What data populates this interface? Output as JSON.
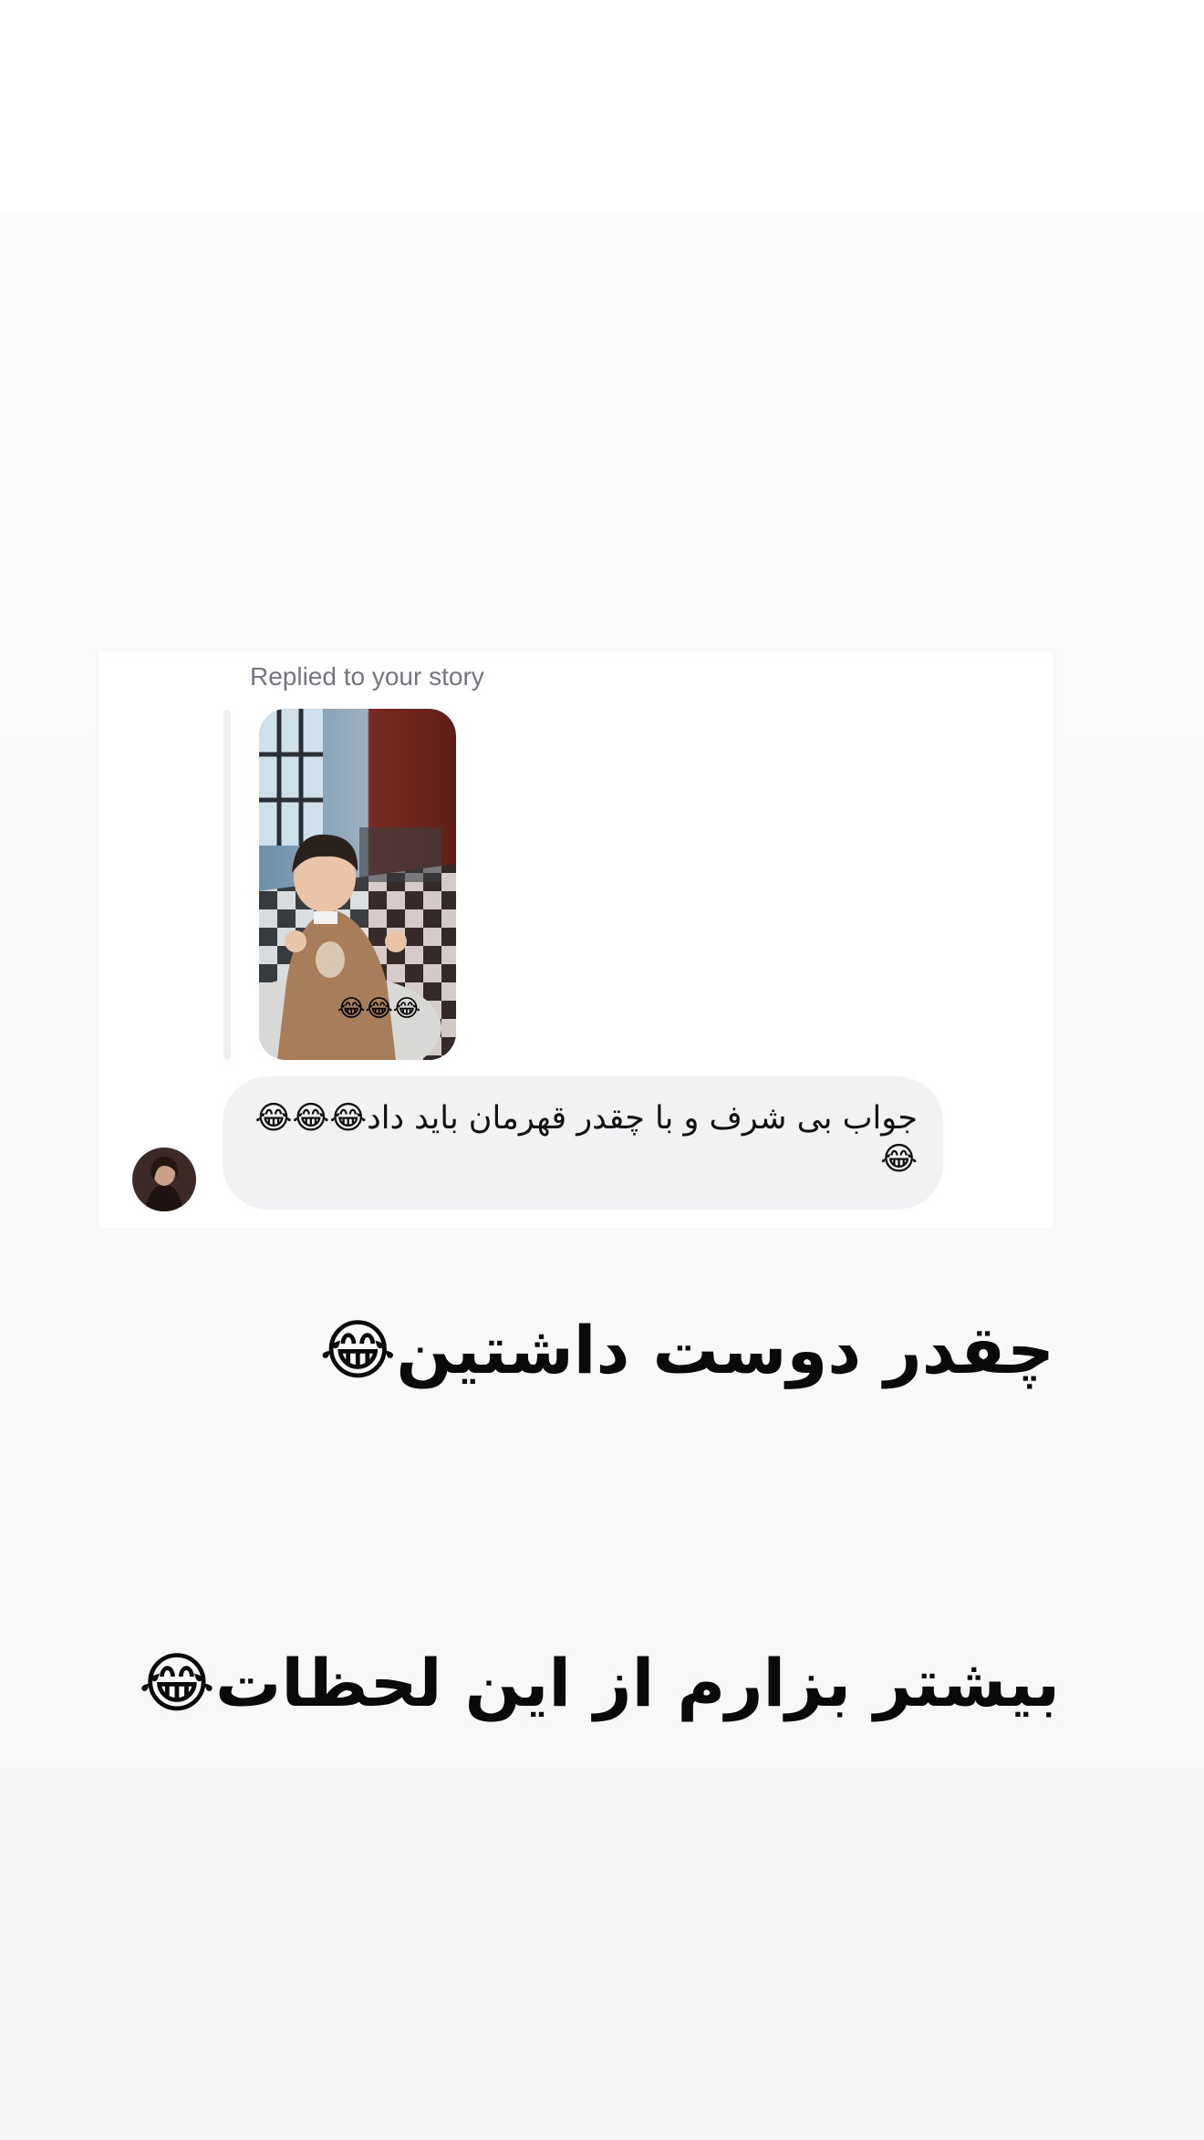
{
  "story_reply": {
    "label": "Replied to your story",
    "thumbnail_icon": "story-photo",
    "thumbnail_overlay_text": "😂😂😂"
  },
  "message": {
    "text": "جواب بی شرف و با چقدر قهرمان باید داد😂😂😂😂",
    "avatar_icon": "profile-avatar"
  },
  "captions": {
    "line1": "چقدر دوست داشتین😂",
    "line2": "بیشتر بزارم از این لحظات😂"
  },
  "colors": {
    "bubble": "#f1f2f4",
    "label": "#737680",
    "caption_text": "#0a0a0a"
  }
}
